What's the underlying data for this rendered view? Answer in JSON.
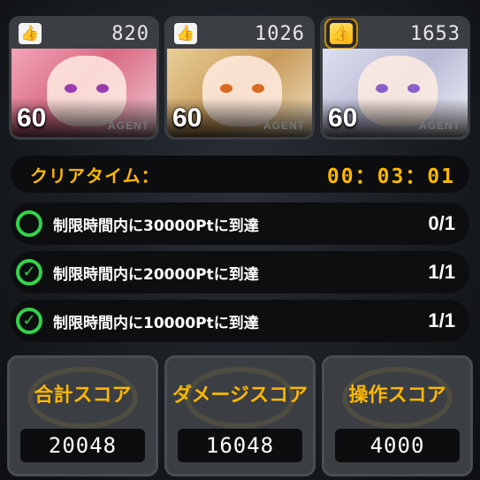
{
  "agents": [
    {
      "likes": "820",
      "level": "60",
      "tag": "AGENT",
      "like_icon": "thumbs-up-icon",
      "top_ranked": false
    },
    {
      "likes": "1026",
      "level": "60",
      "tag": "AGENT",
      "like_icon": "thumbs-up-icon",
      "top_ranked": false
    },
    {
      "likes": "1653",
      "level": "60",
      "tag": "AGENT",
      "like_icon": "gold-thumbs-up-icon",
      "top_ranked": true
    }
  ],
  "clear": {
    "label": "クリアタイム：",
    "time": "00：03：01"
  },
  "missions": [
    {
      "text": "制限時間内に30000Ptに到達",
      "progress": "0/1",
      "completed": false
    },
    {
      "text": "制限時間内に20000Ptに到達",
      "progress": "1/1",
      "completed": true
    },
    {
      "text": "制限時間内に10000Ptに到達",
      "progress": "1/1",
      "completed": true
    }
  ],
  "scores": [
    {
      "label": "合計スコア",
      "value": "20048"
    },
    {
      "label": "ダメージスコア",
      "value": "16048"
    },
    {
      "label": "操作スコア",
      "value": "4000"
    }
  ],
  "colors": {
    "accent": "#ffb700",
    "check": "#35d14a",
    "panel": "#0c0d0f"
  }
}
